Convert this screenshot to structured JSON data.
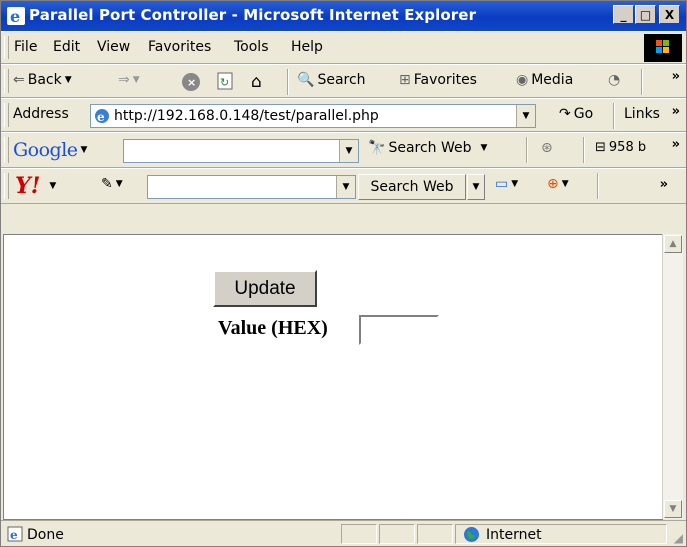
{
  "window": {
    "title": "Parallel Port Controller - Microsoft Internet Explorer",
    "minimize": "_",
    "maximize": "□",
    "close": "X"
  },
  "menu": [
    "File",
    "Edit",
    "View",
    "Favorites",
    "Tools",
    "Help"
  ],
  "toolbar": {
    "back": "Back",
    "search": "Search",
    "favorites": "Favorites",
    "media": "Media",
    "more": "»"
  },
  "address": {
    "label": "Address",
    "url": "http://192.168.0.148/test/parallel.php",
    "go": "Go",
    "links": "Links",
    "more": "»"
  },
  "google": {
    "logo": "Google",
    "search_web": "Search Web",
    "count": "958 b",
    "more": "»"
  },
  "yahoo": {
    "logo": "Y!",
    "search_web": "Search Web",
    "more": "»"
  },
  "page": {
    "update_button": "Update",
    "value_label": "Value (HEX)",
    "value_input": ""
  },
  "status": {
    "text": "Done",
    "zone": "Internet"
  },
  "colors": {
    "titlebar": "#0a3cc0",
    "chrome": "#ece9d8"
  }
}
